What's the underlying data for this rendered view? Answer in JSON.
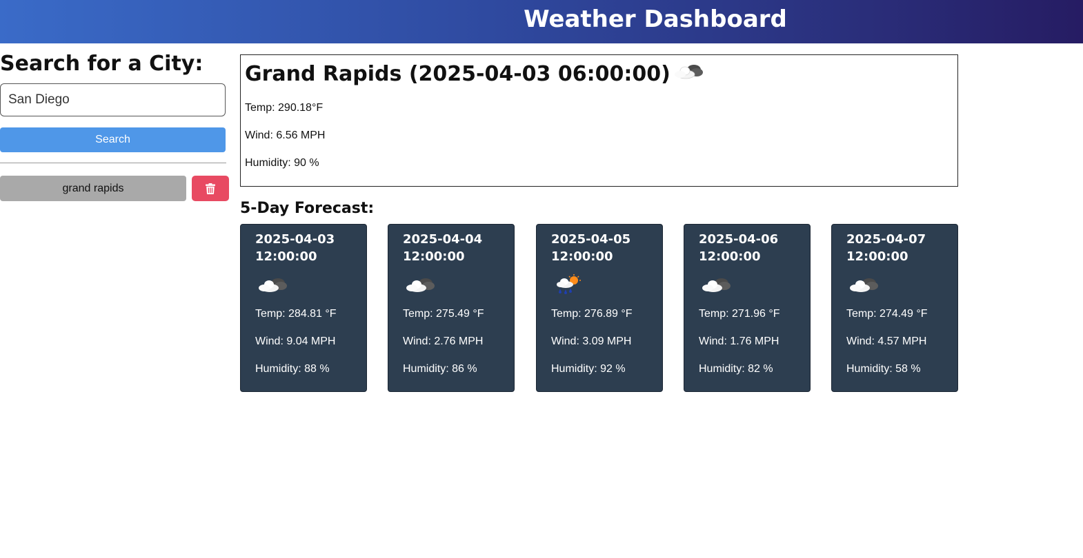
{
  "header": {
    "title": "Weather Dashboard"
  },
  "search": {
    "heading": "Search for a City:",
    "input_value": "San Diego",
    "button_label": "Search"
  },
  "history": {
    "items": [
      {
        "label": "grand rapids"
      }
    ],
    "delete_icon": "trash-icon"
  },
  "current": {
    "title": "Grand Rapids (2025-04-03 06:00:00)",
    "icon": "cloudy-icon",
    "temp": "Temp: 290.18°F",
    "wind": "Wind: 6.56 MPH",
    "humidity": "Humidity: 90 %"
  },
  "forecast": {
    "heading": "5-Day Forecast:",
    "days": [
      {
        "date": "2025-04-03 12:00:00",
        "icon": "cloudy-icon",
        "temp": "Temp: 284.81 °F",
        "wind": "Wind: 9.04 MPH",
        "humidity": "Humidity: 88 %"
      },
      {
        "date": "2025-04-04 12:00:00",
        "icon": "cloudy-icon",
        "temp": "Temp: 275.49 °F",
        "wind": "Wind: 2.76 MPH",
        "humidity": "Humidity: 86 %"
      },
      {
        "date": "2025-04-05 12:00:00",
        "icon": "rain-sun-icon",
        "temp": "Temp: 276.89 °F",
        "wind": "Wind: 3.09 MPH",
        "humidity": "Humidity: 92 %"
      },
      {
        "date": "2025-04-06 12:00:00",
        "icon": "cloudy-icon",
        "temp": "Temp: 271.96 °F",
        "wind": "Wind: 1.76 MPH",
        "humidity": "Humidity: 82 %"
      },
      {
        "date": "2025-04-07 12:00:00",
        "icon": "cloudy-icon",
        "temp": "Temp: 274.49 °F",
        "wind": "Wind: 4.57 MPH",
        "humidity": "Humidity: 58 %"
      }
    ]
  },
  "colors": {
    "header_start": "#3a6bc8",
    "header_end": "#261c63",
    "search_button": "#4f97e8",
    "history_button": "#a9a9a9",
    "delete_button": "#e84a62",
    "forecast_card": "#2d3e50"
  }
}
